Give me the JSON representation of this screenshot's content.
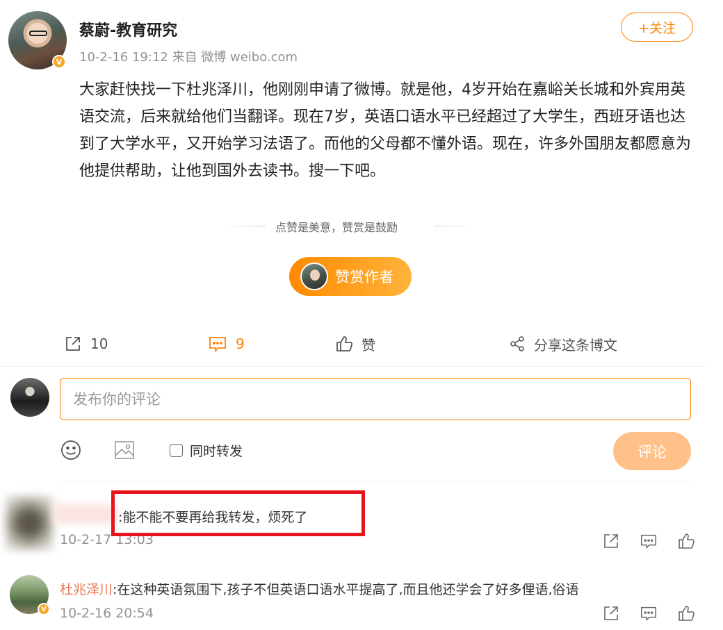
{
  "post": {
    "author": "蔡蔚-教育研究",
    "meta": "10-2-16 19:12  来自 微博 weibo.com",
    "verified_badge": "V",
    "follow_label": "+关注",
    "body": "大家赶快找一下杜兆泽川，他刚刚申请了微博。就是他，4岁开始在嘉峪关长城和外宾用英语交流，后来就给他们当翻译。现在7岁，英语口语水平已经超过了大学生，西班牙语也达到了大学水平，又开始学习法语了。而他的父母都不懂外语。现在，许多外国朋友都愿意为他提供帮助，让他到国外去读书。搜一下吧。"
  },
  "reward": {
    "tip": "点赞是美意，赞赏是鼓励",
    "button_label": "赞赏作者"
  },
  "actions": {
    "repost_count": "10",
    "comment_count": "9",
    "like_label": "赞",
    "share_label": "分享这条博文"
  },
  "composer": {
    "placeholder": "发布你的评论",
    "repost_label": "同时转发",
    "submit_label": "评论"
  },
  "comments": [
    {
      "user": "",
      "text": ":能不能不要再给我转发，烦死了",
      "time": "10-2-17 13:03"
    },
    {
      "user": "杜兆泽川",
      "text": ":在这种英语氛围下,孩子不但英语口语水平提高了,而且他还学会了好多俚语,俗语",
      "time": "10-2-16 20:54",
      "verified_badge": "V"
    }
  ],
  "colors": {
    "accent": "#ff8200",
    "highlight": "#e8141c",
    "link": "#eb7350"
  }
}
